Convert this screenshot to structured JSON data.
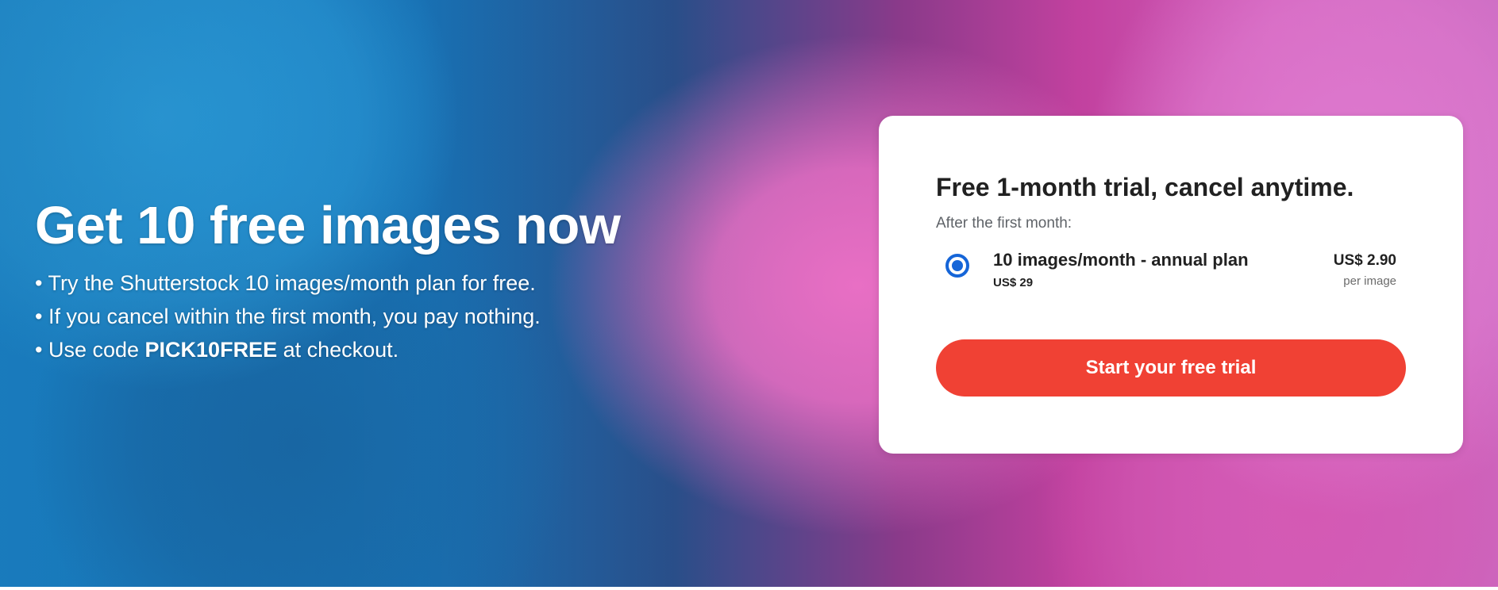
{
  "hero": {
    "headline": "Get 10 free images now",
    "bullets": {
      "b1": "• Try the Shutterstock 10 images/month plan for free.",
      "b2": "• If you cancel within the first month, you pay nothing.",
      "b3_prefix": "• Use code ",
      "b3_code": "PICK10FREE",
      "b3_suffix": " at checkout."
    }
  },
  "card": {
    "title": "Free 1-month trial, cancel anytime.",
    "subtitle": "After the first month:",
    "plan": {
      "name": "10 images/month - annual plan",
      "total": "US$ 29",
      "price": "US$ 2.90",
      "unit": "per image",
      "selected": true
    },
    "cta_label": "Start your free trial"
  },
  "colors": {
    "cta": "#f04134",
    "radio": "#1565d8",
    "card_bg": "#ffffff",
    "hero_blue": "#1e8fd6",
    "hero_pink": "#cf5eb9"
  },
  "icons": {
    "radio": "radio-selected-icon"
  }
}
